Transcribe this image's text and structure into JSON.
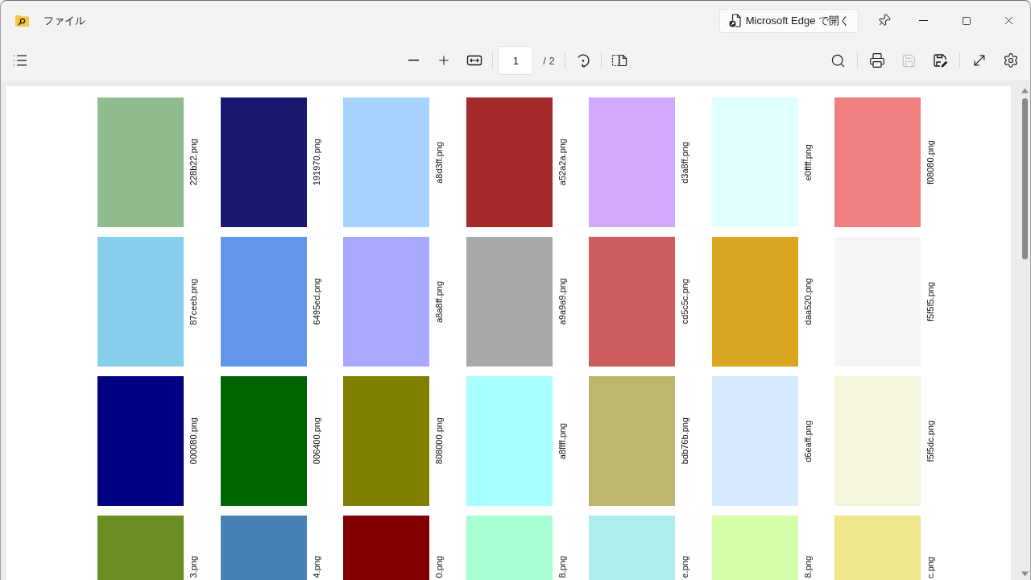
{
  "window": {
    "title": "ファイル",
    "open_button": "Microsoft Edge で開く"
  },
  "toolbar": {
    "page_field": {
      "value": "1"
    },
    "page_total": "/ 2",
    "save": {
      "disabled": true
    }
  },
  "document": {
    "rows": [
      {
        "tiles": [
          {
            "label": "228b22.png",
            "color": "#8fbc8f"
          },
          {
            "label": "191970.png",
            "color": "#191970"
          },
          {
            "label": "a8d3ff.png",
            "color": "#a8d3ff"
          },
          {
            "label": "a52a2a.png",
            "color": "#a52a2a"
          },
          {
            "label": "d3a8ff.png",
            "color": "#d3a8ff"
          },
          {
            "label": "e0ffff.png",
            "color": "#e0ffff"
          },
          {
            "label": "f08080.png",
            "color": "#f08080"
          }
        ]
      },
      {
        "tiles": [
          {
            "label": "87ceeb.png",
            "color": "#87ceeb"
          },
          {
            "label": "6495ed.png",
            "color": "#6495ed"
          },
          {
            "label": "a8a8ff.png",
            "color": "#a8a8ff"
          },
          {
            "label": "a9a9a9.png",
            "color": "#a9a9a9"
          },
          {
            "label": "cd5c5c.png",
            "color": "#cd5c5c"
          },
          {
            "label": "daa520.png",
            "color": "#daa520"
          },
          {
            "label": "f5f5f5.png",
            "color": "#f5f5f5"
          }
        ]
      },
      {
        "tiles": [
          {
            "label": "000080.png",
            "color": "#000080"
          },
          {
            "label": "006400.png",
            "color": "#006400"
          },
          {
            "label": "808000.png",
            "color": "#808000"
          },
          {
            "label": "a8ffff.png",
            "color": "#a8ffff"
          },
          {
            "label": "bdb76b.png",
            "color": "#bdb76b"
          },
          {
            "label": "d6eaff.png",
            "color": "#d6eaff"
          },
          {
            "label": "f5f5dc.png",
            "color": "#f5f5dc"
          }
        ]
      },
      {
        "tiles": [
          {
            "label": "3.png",
            "color": "#6b8e23"
          },
          {
            "label": "4.png",
            "color": "#4682b4"
          },
          {
            "label": "0.png",
            "color": "#800000"
          },
          {
            "label": "8.png",
            "color": "#a8ffd4"
          },
          {
            "label": "e.png",
            "color": "#afeeee"
          },
          {
            "label": "8.png",
            "color": "#d4ffa8"
          },
          {
            "label": "c.png",
            "color": "#f0e68c"
          }
        ]
      }
    ]
  }
}
